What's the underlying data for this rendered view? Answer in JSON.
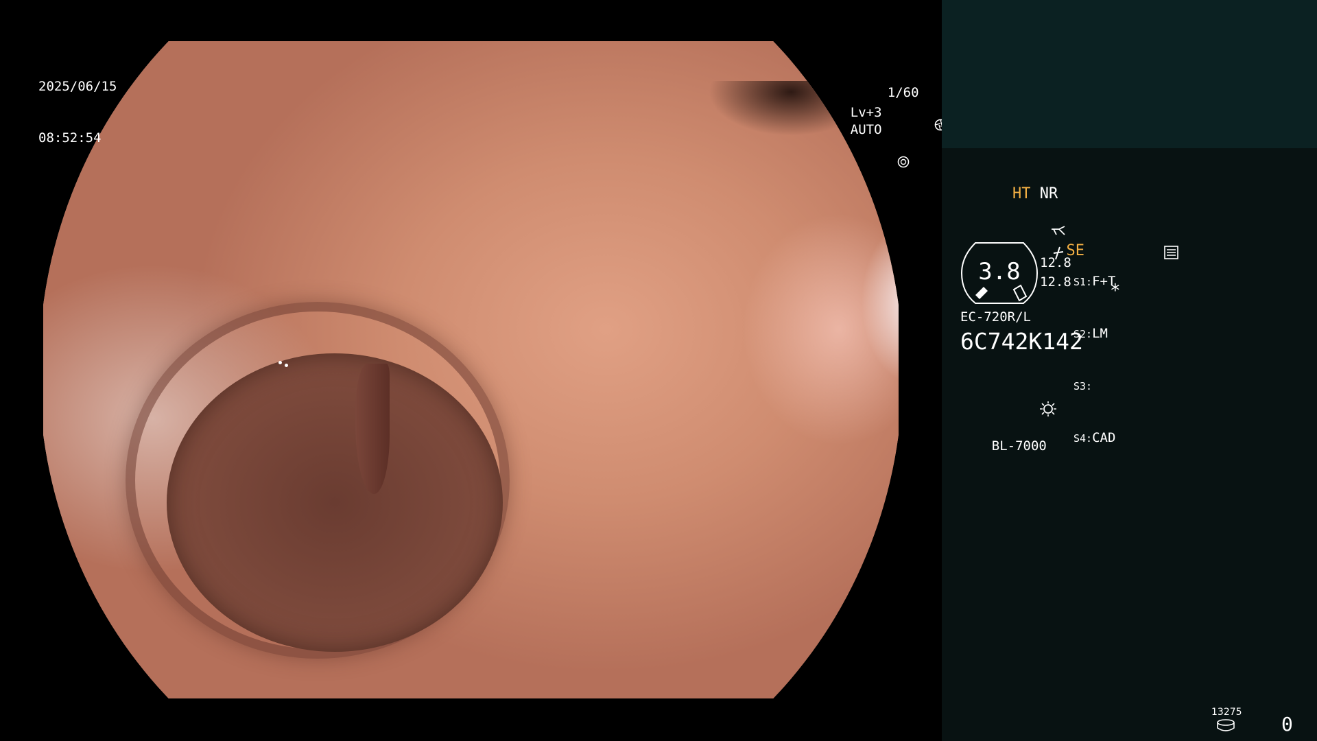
{
  "overlay": {
    "date": "2025/06/15",
    "time": "08:52:54",
    "shutter": "1/60",
    "level": "Lv+3",
    "mode": "AUTO"
  },
  "panel": {
    "ht": "HT",
    "nr": "NR",
    "se": "SE",
    "zoom_value": "3.8",
    "val_a": "12.8",
    "val_b": "12.8",
    "s1_label": "S1:",
    "s1_value": "F+T",
    "s2_label": "S2:",
    "s2_value": "LM",
    "s3_label": "S3:",
    "s3_value": "",
    "s4_label": "S4:",
    "s4_value": "CAD",
    "asterisk": "*",
    "scope_model": "EC-720R/L",
    "serial": "6C742K142",
    "light_source": "BL-7000",
    "counter_small": "13275",
    "counter_big": "0"
  },
  "colors": {
    "accent": "#f4b044",
    "panel_bg": "#081212",
    "panel_top_bg": "#0b2122"
  },
  "icons": {
    "shutter": "aperture-icon",
    "mode": "iris-icon",
    "scope_tool": "forceps-icon",
    "freeze": "lightning-icon",
    "menu": "menu-icon",
    "light": "light-bulb-icon",
    "storage": "disk-icon"
  }
}
